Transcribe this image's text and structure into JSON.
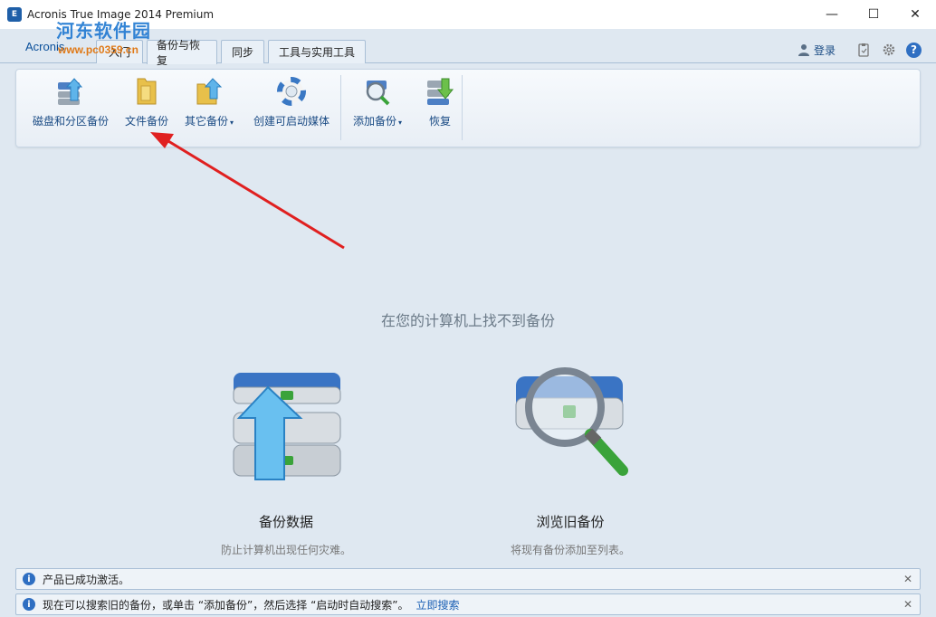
{
  "window": {
    "title": "Acronis True Image 2014 Premium",
    "app_icon_label": "E",
    "minimize": "—",
    "maximize": "☐",
    "close": "✕"
  },
  "brand": {
    "logo": "Acronis",
    "watermark": "河东软件园",
    "watermark_url": "www.pc0359.cn"
  },
  "tabs": [
    {
      "label": "入门",
      "active": false
    },
    {
      "label": "备份与恢复",
      "active": true
    },
    {
      "label": "同步",
      "active": false
    },
    {
      "label": "工具与实用工具",
      "active": false
    }
  ],
  "header_right": {
    "login_label": "登录",
    "icons": [
      "clipboard-icon",
      "gear-icon",
      "help-icon"
    ],
    "help_glyph": "?"
  },
  "toolbar": {
    "items": [
      {
        "label": "磁盘和分区备份",
        "icon": "disk-backup-icon",
        "dropdown": false
      },
      {
        "label": "文件备份",
        "icon": "folder-icon",
        "dropdown": false
      },
      {
        "label": "其它备份",
        "icon": "other-backup-icon",
        "dropdown": true
      },
      {
        "label": "创建可启动媒体",
        "icon": "lifebuoy-icon",
        "dropdown": false
      },
      {
        "label": "添加备份",
        "icon": "add-backup-icon",
        "dropdown": true
      },
      {
        "label": "恢复",
        "icon": "recover-icon",
        "dropdown": false
      }
    ],
    "caret": "▾"
  },
  "main": {
    "empty_message": "在您的计算机上找不到备份",
    "actions": [
      {
        "title": "备份数据",
        "desc": "防止计算机出现任何灾难。",
        "icon": "backup-stack-icon"
      },
      {
        "title": "浏览旧备份",
        "desc": "将现有备份添加至列表。",
        "icon": "magnifier-disk-icon"
      }
    ]
  },
  "notifications": [
    {
      "text": "产品已成功激活。",
      "link": "",
      "close": "✕"
    },
    {
      "text": "现在可以搜索旧的备份，或单击 “添加备份”，然后选择 “启动时自动搜索”。",
      "link": "立即搜索",
      "close": "✕"
    }
  ],
  "colors": {
    "background": "#dfe8f1",
    "accent": "#1a4b84",
    "arrow": "#e02020",
    "link": "#1a5fb4"
  }
}
